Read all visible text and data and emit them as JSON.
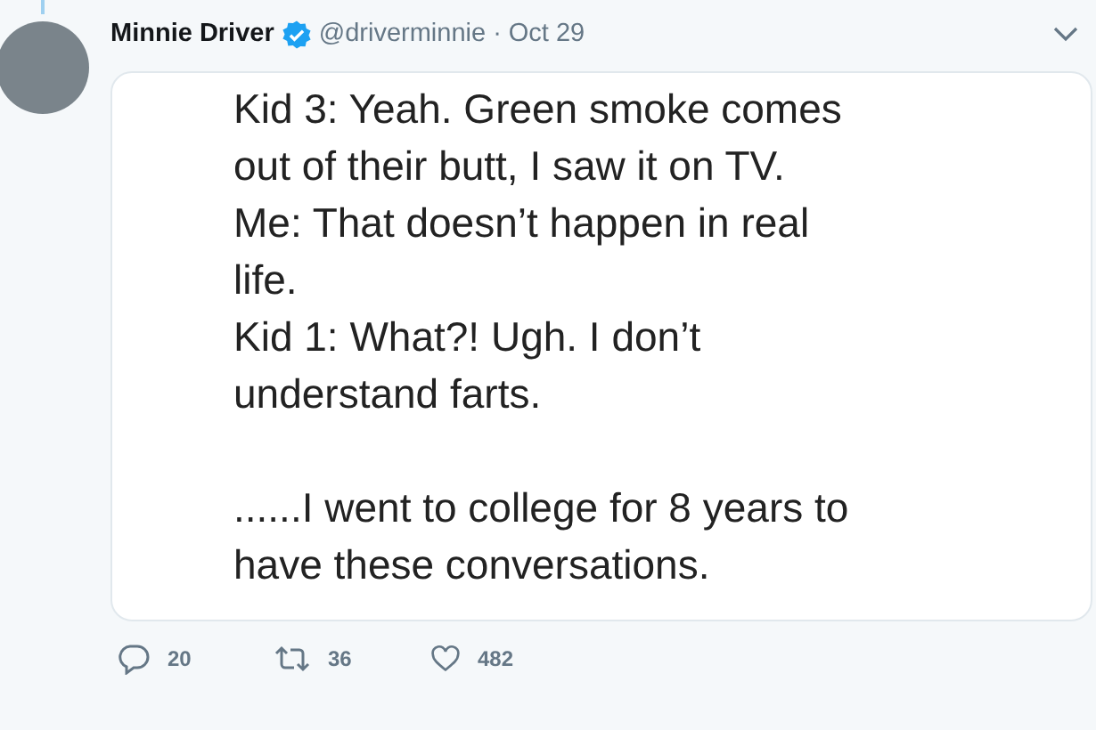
{
  "tweet": {
    "author": {
      "name": "Minnie Driver",
      "verified": true,
      "handle": "@driverminnie",
      "separator": "·",
      "date": "Oct 29"
    },
    "image_text": [
      [
        "Kid 3: Yeah. Green smoke comes",
        "out of their butt, I saw it on TV.",
        "Me: That doesn’t happen in real",
        "life.",
        "Kid 1: What?! Ugh. I don’t",
        "understand farts."
      ],
      [
        "......I went to college for 8 years to",
        "have these conversations."
      ]
    ],
    "actions": [
      {
        "kind": "reply",
        "count": "20"
      },
      {
        "kind": "retweet",
        "count": "36"
      },
      {
        "kind": "like",
        "count": "482"
      }
    ]
  }
}
